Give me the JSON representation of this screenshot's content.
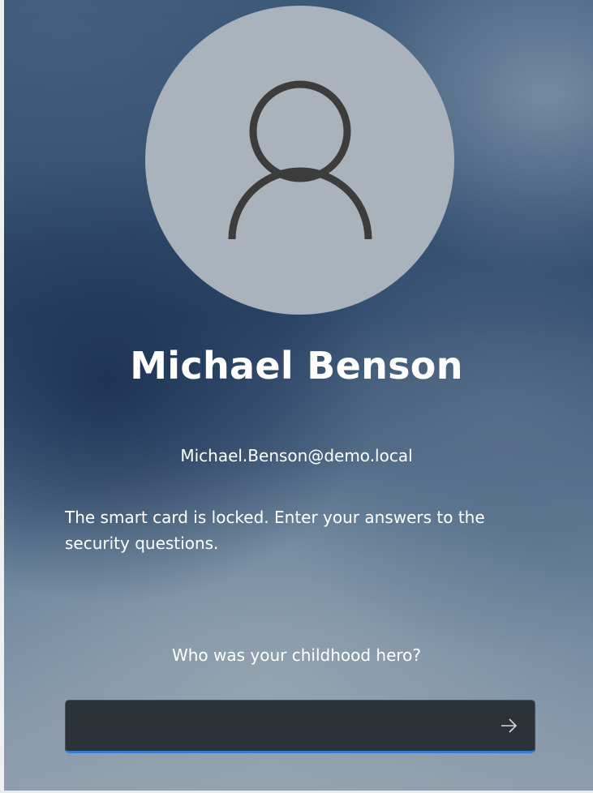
{
  "user": {
    "name": "Michael Benson",
    "email": "Michael.Benson@demo.local",
    "avatar_icon": "user-silhouette-icon"
  },
  "message": "The smart card is locked. Enter your answers to the security questions.",
  "security_question": {
    "text": "Who was your childhood hero?",
    "answer_value": "",
    "submit_icon": "arrow-right-icon"
  },
  "colors": {
    "avatar_bg": "#aab2bc",
    "avatar_icon": "#3c3c3c",
    "input_bg": "#2d3138",
    "input_accent": "#2f7fd3",
    "text": "#ffffff"
  }
}
